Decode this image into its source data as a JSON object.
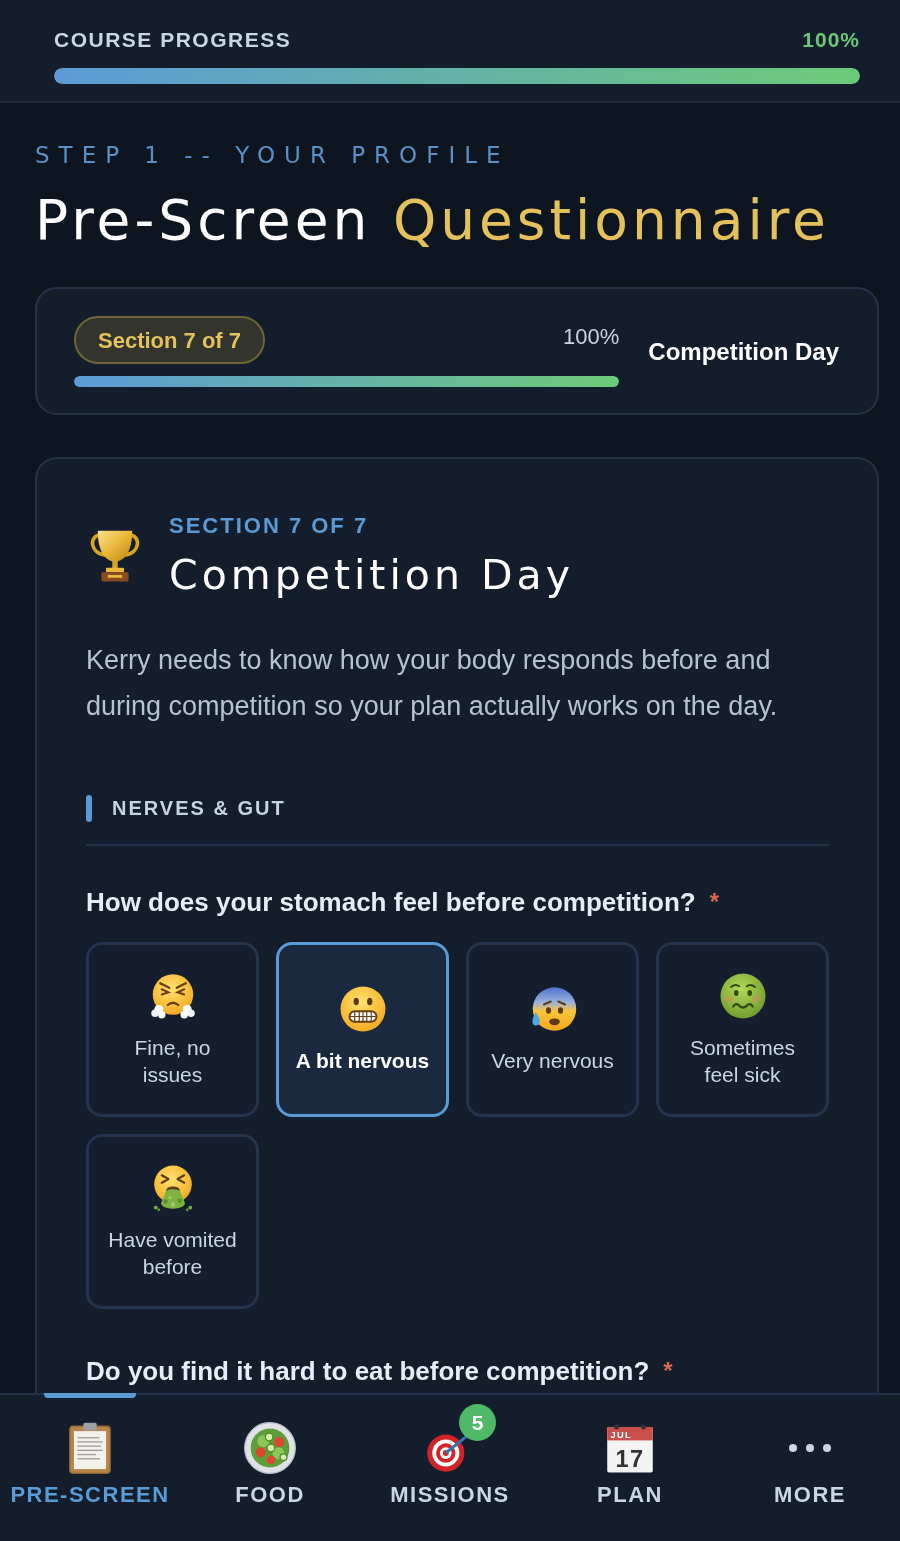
{
  "course_progress": {
    "label": "COURSE PROGRESS",
    "value": "100%",
    "level": 1
  },
  "header": {
    "step": "STEP 1 -- YOUR PROFILE",
    "title_lead": "Pre-Screen",
    "title_accent": "Questionnaire"
  },
  "section_progress": {
    "badge": "Section 7 of 7",
    "value": "100%",
    "level": 1,
    "section_name": "Competition Day"
  },
  "section": {
    "eyebrow": "SECTION 7 OF 7",
    "title": "Competition Day",
    "description": "Kerry needs to know how your body responds before and during competition so your plan actually works on the day.",
    "groups": [
      {
        "heading": "NERVES & GUT",
        "questions": [
          {
            "text": "How does your stomach feel before competition?",
            "required_mark": "*",
            "options": [
              {
                "label": "Fine, no issues",
                "selected": false
              },
              {
                "label": "A bit nervous",
                "selected": true
              },
              {
                "label": "Very nervous",
                "selected": false
              },
              {
                "label": "Sometimes feel sick",
                "selected": false
              },
              {
                "label": "Have vomited before",
                "selected": false
              }
            ]
          },
          {
            "text": "Do you find it hard to eat before competition?",
            "required_mark": "*"
          }
        ]
      }
    ]
  },
  "nav": [
    {
      "label": "PRE-SCREEN",
      "selected": true
    },
    {
      "label": "FOOD",
      "selected": false
    },
    {
      "label": "MISSIONS",
      "selected": false,
      "badge": "5"
    },
    {
      "label": "PLAN",
      "selected": false,
      "calendar_month": "JUL",
      "calendar_day": "17"
    },
    {
      "label": "MORE",
      "selected": false
    }
  ]
}
